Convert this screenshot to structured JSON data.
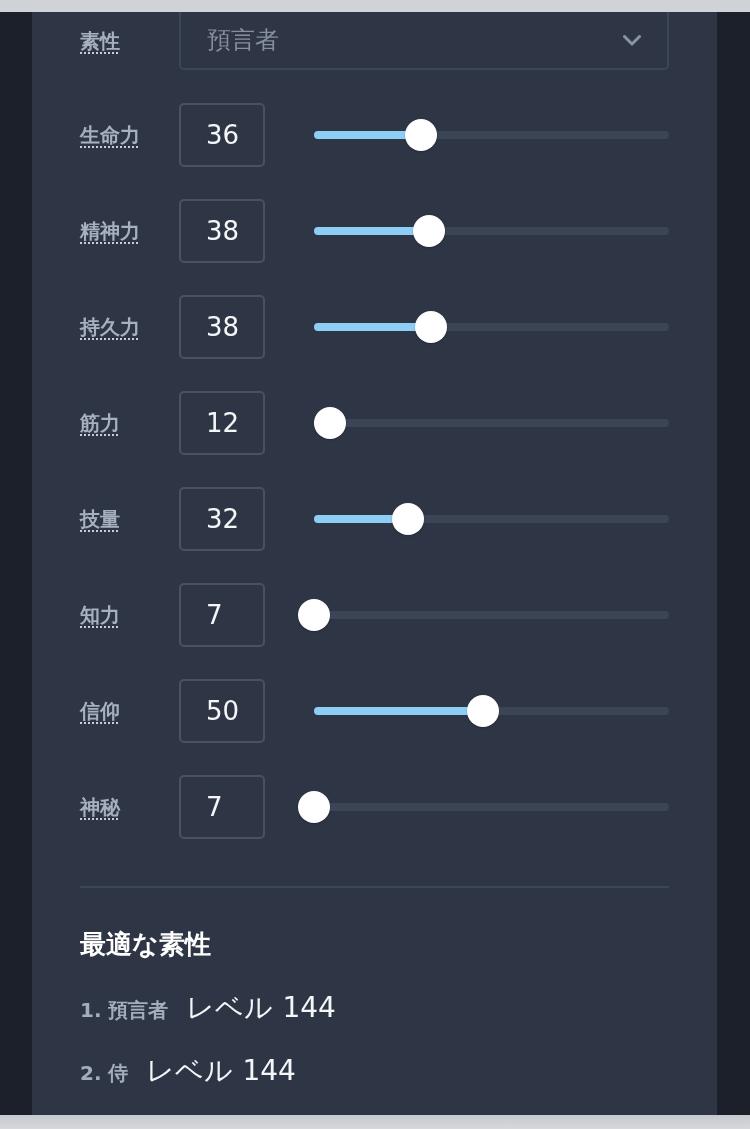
{
  "class_select": {
    "label": "素性",
    "placeholder": "預言者"
  },
  "stats": [
    {
      "label": "生命力",
      "value": "36",
      "level": 0.301
    },
    {
      "label": "精神力",
      "value": "38",
      "level": 0.324
    },
    {
      "label": "持久力",
      "value": "38",
      "level": 0.33
    },
    {
      "label": "筋力",
      "value": "12",
      "level": 0.045
    },
    {
      "label": "技量",
      "value": "32",
      "level": 0.265
    },
    {
      "label": "知力",
      "value": "7",
      "level": 0
    },
    {
      "label": "信仰",
      "value": "50",
      "level": 0.476
    },
    {
      "label": "神秘",
      "value": "7",
      "level": 0
    }
  ],
  "best_classes": {
    "title": "最適な素性",
    "items": [
      {
        "label": "1. 預言者",
        "result": "レベル 144"
      },
      {
        "label": "2. 侍",
        "result": "レベル 144"
      }
    ]
  }
}
